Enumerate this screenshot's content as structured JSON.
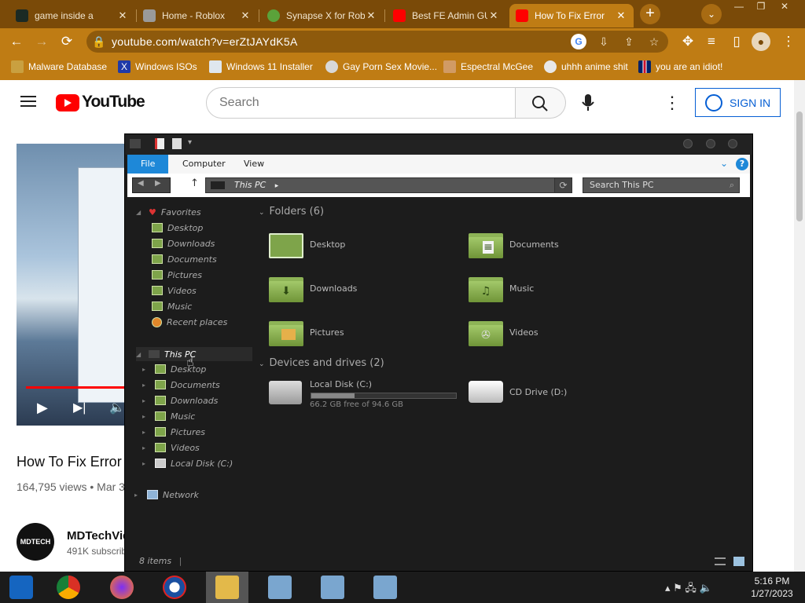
{
  "browser": {
    "tabs": [
      {
        "title": "game inside a",
        "close": "✕",
        "favicon_color": "#1b2a24"
      },
      {
        "title": "Home - Roblox",
        "close": "✕",
        "favicon_color": "#9a9a9a"
      },
      {
        "title": "Synapse X for Rob",
        "close": "✕",
        "favicon_color": "#5ba23a"
      },
      {
        "title": "Best FE Admin GU",
        "close": "✕",
        "favicon_color": "#ff0000"
      },
      {
        "title": "How To Fix Error",
        "close": "✕",
        "favicon_color": "#ff0000",
        "active": true
      }
    ],
    "new_tab": "+",
    "tab_menu": "⌄",
    "window_controls": {
      "minimize": "—",
      "maximize": "❐",
      "close": "✕"
    },
    "nav": {
      "back": "←",
      "forward": "→",
      "reload": "⟳"
    },
    "url": "youtube.com/watch?v=erZtJAYdK5A",
    "bookmarks": [
      {
        "label": "Malware Database",
        "icon": "malware-icon",
        "color": "#c9a040"
      },
      {
        "label": "Windows ISOs",
        "icon": "x-icon",
        "color": "#1f3aa8"
      },
      {
        "label": "Windows 11 Installer",
        "icon": "doc-icon",
        "color": "#dfe7ee"
      },
      {
        "label": "Gay Porn Sex Movie...",
        "icon": "bookmark-icon",
        "color": "#d8d8d8"
      },
      {
        "label": "Espectral McGee",
        "icon": "face-icon",
        "color": "#d19b65"
      },
      {
        "label": "uhhh anime shit",
        "icon": "anime-icon",
        "color": "#e8e8e8"
      },
      {
        "label": "you are an idiot!",
        "icon": "flag-icon",
        "color": "#c8102e"
      }
    ]
  },
  "youtube": {
    "logo": "YouTube",
    "search_placeholder": "Search",
    "signin": "SIGN IN",
    "video_title": "How To Fix Error",
    "views": "164,795 views • Mar 3",
    "channel_name": "MDTechVide",
    "channel_subs": "491K subscrib",
    "channel_avatar_text": "MDTECH",
    "progress": 0.2,
    "controls": {
      "play": "▶",
      "next": "▶|",
      "volume": "🔈"
    }
  },
  "explorer": {
    "ribbon_tabs": [
      "File",
      "Computer",
      "View"
    ],
    "address": "This PC",
    "search_placeholder": "Search This PC",
    "refresh": "⟳",
    "up": "↑",
    "help": "?",
    "ribbon_expand": "⌄",
    "sidebar": {
      "favorites": {
        "label": "Favorites",
        "items": [
          "Desktop",
          "Downloads",
          "Documents",
          "Pictures",
          "Videos",
          "Music",
          "Recent places"
        ]
      },
      "this_pc": {
        "label": "This PC",
        "items": [
          "Desktop",
          "Documents",
          "Downloads",
          "Music",
          "Pictures",
          "Videos",
          "Local Disk (C:)"
        ]
      },
      "network": {
        "label": "Network"
      }
    },
    "folders_header": "Folders (6)",
    "folders": [
      "Desktop",
      "Documents",
      "Downloads",
      "Music",
      "Pictures",
      "Videos"
    ],
    "devices_header": "Devices and drives (2)",
    "drives": [
      {
        "name": "Local Disk (C:)",
        "free": "66.2 GB free of 94.6 GB",
        "used_fraction": 0.3
      },
      {
        "name": "CD Drive (D:)"
      }
    ],
    "status": "8 items"
  },
  "taskbar": {
    "apps": [
      {
        "name": "start-icon",
        "color": "#1565c0"
      },
      {
        "name": "chrome-icon",
        "color": "#d93025"
      },
      {
        "name": "firefox-icon",
        "color": "#ff7b1a"
      },
      {
        "name": "obama-icon",
        "color": "#1a4fa0"
      },
      {
        "name": "explorer-icon",
        "color": "#e3b94a"
      },
      {
        "name": "network-app-icon-1",
        "color": "#7aa6cf"
      },
      {
        "name": "network-app-icon-2",
        "color": "#7aa6cf"
      },
      {
        "name": "network-app-icon-3",
        "color": "#7aa6cf"
      }
    ],
    "tray": "▴  ⚑  🖧  🔈",
    "time": "5:16 PM",
    "date": "1/27/2023"
  }
}
